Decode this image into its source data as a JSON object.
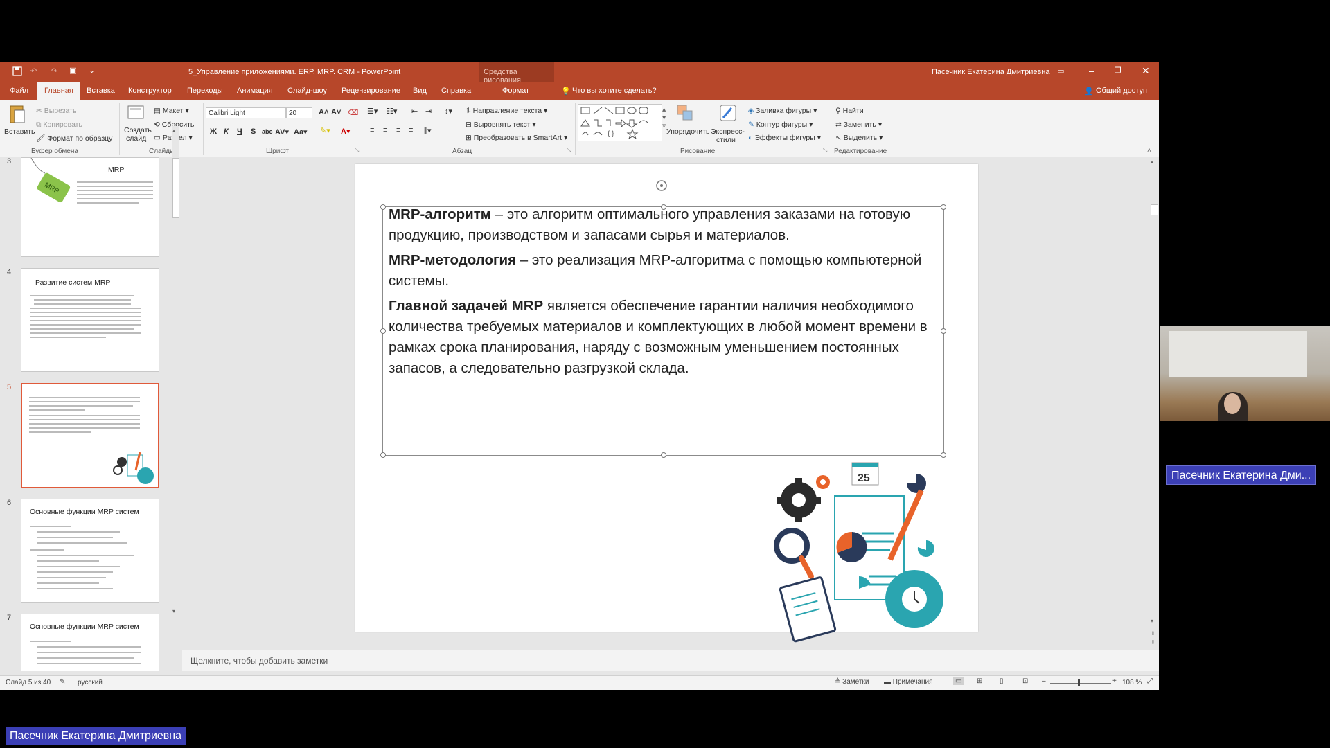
{
  "window": {
    "title": "5_Управление приложениями. ERP. MRP. CRM  -  PowerPoint",
    "context_tool": "Средства рисования",
    "user": "Пасечник Екатерина Дмитриевна"
  },
  "ribbon_tabs": [
    "Файл",
    "Главная",
    "Вставка",
    "Конструктор",
    "Переходы",
    "Анимация",
    "Слайд-шоу",
    "Рецензирование",
    "Вид",
    "Справка",
    "Формат"
  ],
  "tell_me": "Что вы хотите сделать?",
  "share": "Общий доступ",
  "clipboard": {
    "paste": "Вставить",
    "cut": "Вырезать",
    "copy": "Копировать",
    "format_painter": "Формат по образцу",
    "group": "Буфер обмена"
  },
  "slides_group": {
    "new_slide": "Создать",
    "new_slide2": "слайд",
    "layout": "Макет",
    "reset": "Сбросить",
    "section": "Раздел",
    "group": "Слайды"
  },
  "font": {
    "name": "Calibri Light",
    "size": "20",
    "group": "Шрифт",
    "bold": "Ж",
    "italic": "К",
    "underline": "Ч",
    "shadow": "S",
    "strike": "abc"
  },
  "paragraph": {
    "text_direction": "Направление текста",
    "align_text": "Выровнять текст",
    "smartart": "Преобразовать в SmartArt",
    "group": "Абзац"
  },
  "drawing": {
    "arrange": "Упорядочить",
    "quick_styles": "Экспресс-",
    "quick_styles2": "стили",
    "fill": "Заливка фигуры",
    "outline": "Контур фигуры",
    "effects": "Эффекты фигуры",
    "group": "Рисование"
  },
  "editing": {
    "find": "Найти",
    "replace": "Заменить",
    "select": "Выделить",
    "group": "Редактирование"
  },
  "thumbnails": [
    {
      "num": "3",
      "title": "MRP"
    },
    {
      "num": "4",
      "title": "Развитие систем MRP"
    },
    {
      "num": "5",
      "title": ""
    },
    {
      "num": "6",
      "title": "Основные функции MRP систем"
    },
    {
      "num": "7",
      "title": "Основные функции MRP систем"
    }
  ],
  "slide": {
    "p1_bold": "MRP-алгоритм",
    "p1_rest": " – это алгоритм оптимального управления заказами на готовую продукцию, производством и запасами сырья и материалов.",
    "p2_bold": "MRP-методология",
    "p2_rest": " – это реализация MRP-алгоритма с помощью компьютерной системы.",
    "p3_bold": "Главной задачей MRP",
    "p3_rest": " является обеспечение гарантии наличия необходимого количества требуемых материалов и комплектующих в любой момент времени в рамках срока планирования, наряду с возможным уменьшением постоянных запасов, а следовательно разгрузкой склада.",
    "calendar_day": "25"
  },
  "notes_placeholder": "Щелкните, чтобы добавить заметки",
  "status": {
    "slide": "Слайд 5 из 40",
    "language": "русский",
    "notes": "Заметки",
    "comments": "Примечания",
    "zoom": "108 %"
  },
  "overlays": {
    "name_right": "Пасечник Екатерина Дми...",
    "name_bottom": "Пасечник Екатерина Дмитриевна"
  },
  "colors": {
    "accent": "#b7472a",
    "overlay": "#3b3fb5",
    "teal": "#2aa5b0",
    "orange": "#e8632a"
  }
}
